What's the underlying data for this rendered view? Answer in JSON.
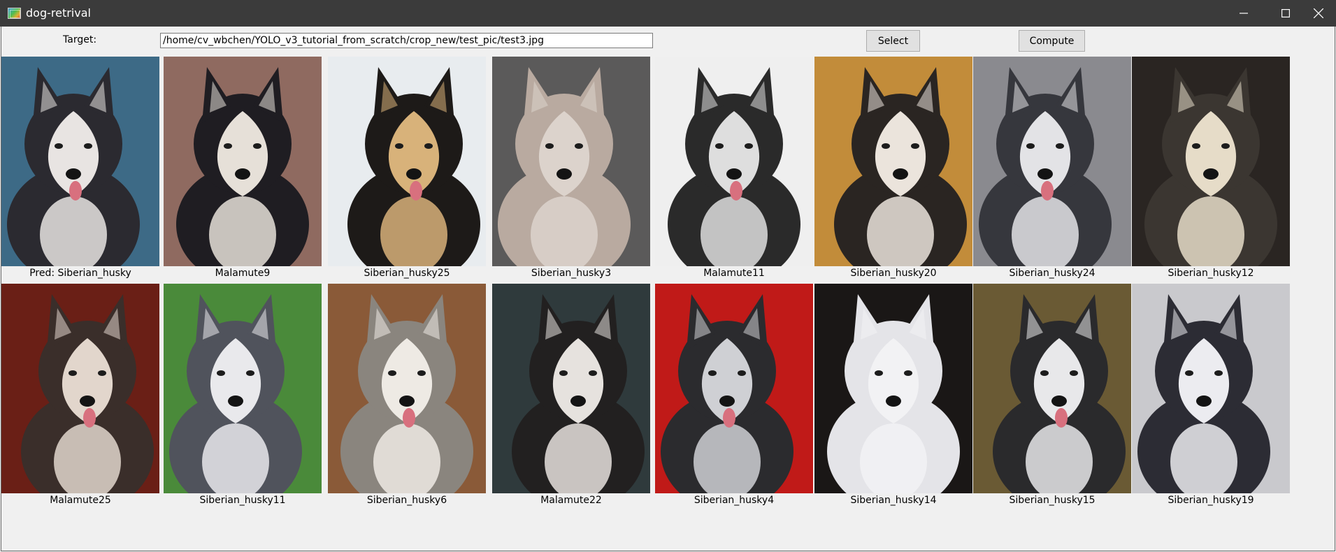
{
  "window": {
    "title": "dog-retrival",
    "icon": "app-icon",
    "controls": [
      "minimize-icon",
      "maximize-icon",
      "close-icon"
    ]
  },
  "toolbar": {
    "target_label": "Target:",
    "path_value": "/home/cv_wbchen/YOLO_v3_tutorial_from_scratch/crop_new/test_pic/test3.jpg",
    "select_label": "Select",
    "compute_label": "Compute"
  },
  "results": {
    "row1": [
      {
        "caption": "Pred: Siberian_husky",
        "bg": "#3d6a86",
        "fur": "#2b2a30",
        "face": "#e8e4e2"
      },
      {
        "caption": "Malamute9",
        "bg": "#8f6a60",
        "fur": "#1f1d22",
        "face": "#e6e0d8"
      },
      {
        "caption": "Siberian_husky25",
        "bg": "#e8ecef",
        "fur": "#1d1a18",
        "face": "#d8b27a"
      },
      {
        "caption": "Siberian_husky3",
        "bg": "#5b5a5a",
        "fur": "#b9aaa0",
        "face": "#dcd3cc"
      },
      {
        "caption": "Malamute11",
        "bg": "#efefef",
        "fur": "#2a2a2a",
        "face": "#dedede"
      },
      {
        "caption": "Siberian_husky20",
        "bg": "#c28c3a",
        "fur": "#2a2522",
        "face": "#ebe4dc"
      },
      {
        "caption": "Siberian_husky24",
        "bg": "#8a8a8f",
        "fur": "#36373d",
        "face": "#e3e3e6"
      },
      {
        "caption": "Siberian_husky12",
        "bg": "#2a2522",
        "fur": "#3b3631",
        "face": "#e6dcc8"
      }
    ],
    "row2": [
      {
        "caption": "Malamute25",
        "bg": "#6a1f16",
        "fur": "#3a2e2a",
        "face": "#e2d6cc"
      },
      {
        "caption": "Siberian_husky11",
        "bg": "#4a8a3a",
        "fur": "#50535c",
        "face": "#e9e9ec"
      },
      {
        "caption": "Siberian_husky6",
        "bg": "#8a5a38",
        "fur": "#8a857e",
        "face": "#eeeae4"
      },
      {
        "caption": "Malamute22",
        "bg": "#2f3a3c",
        "fur": "#222020",
        "face": "#e6e2de"
      },
      {
        "caption": "Siberian_husky4",
        "bg": "#c01a18",
        "fur": "#2b2b2e",
        "face": "#cfd0d4"
      },
      {
        "caption": "Siberian_husky14",
        "bg": "#1a1716",
        "fur": "#e4e4e8",
        "face": "#f2f2f4"
      },
      {
        "caption": "Siberian_husky15",
        "bg": "#6a5a34",
        "fur": "#2a2a2c",
        "face": "#e8e8ea"
      },
      {
        "caption": "Siberian_husky19",
        "bg": "#c9c9cd",
        "fur": "#2c2c34",
        "face": "#ececf0"
      }
    ]
  }
}
